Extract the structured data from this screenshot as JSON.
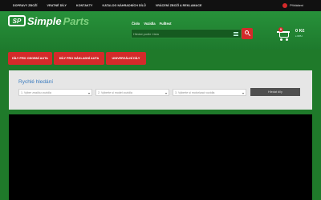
{
  "topnav": {
    "items": [
      "DOPRAVY ZBOŽÍ",
      "VRATNÉ DÍLY",
      "KONTAKTY",
      "KATALOG NÁHRADNÍCH DÍLŮ",
      "VRÁCENÍ ZBOŽÍ A REKLAMACE"
    ],
    "login": "Přihlášení"
  },
  "logo": {
    "badge": "SP",
    "word1": "Simple",
    "word2": "Parts"
  },
  "search": {
    "tabs": [
      "Číslo",
      "Vozidla",
      "Fulltext"
    ],
    "placeholder": "Hledat podle čísla"
  },
  "cart": {
    "count": "0",
    "total": "0 Kč",
    "vat_note": "s DPH"
  },
  "categories": [
    "DÍLY PRO OSOBNÍ AUTA",
    "DÍLY PRO NÁKLADNÍ AUTA",
    "UNIVERZÁLNÍ DÍLY"
  ],
  "quick_search": {
    "title": "Rychlé hledání",
    "selects": [
      "1. Vyber značku vozidla",
      "2. Vyberte si model vozidla",
      "3. Vyberte si motorizaci vozidla"
    ],
    "button": "Hledat díly"
  },
  "colors": {
    "brand_green": "#1f7a2a",
    "accent_red": "#d42a2a",
    "link_blue": "#3a7bbf"
  }
}
